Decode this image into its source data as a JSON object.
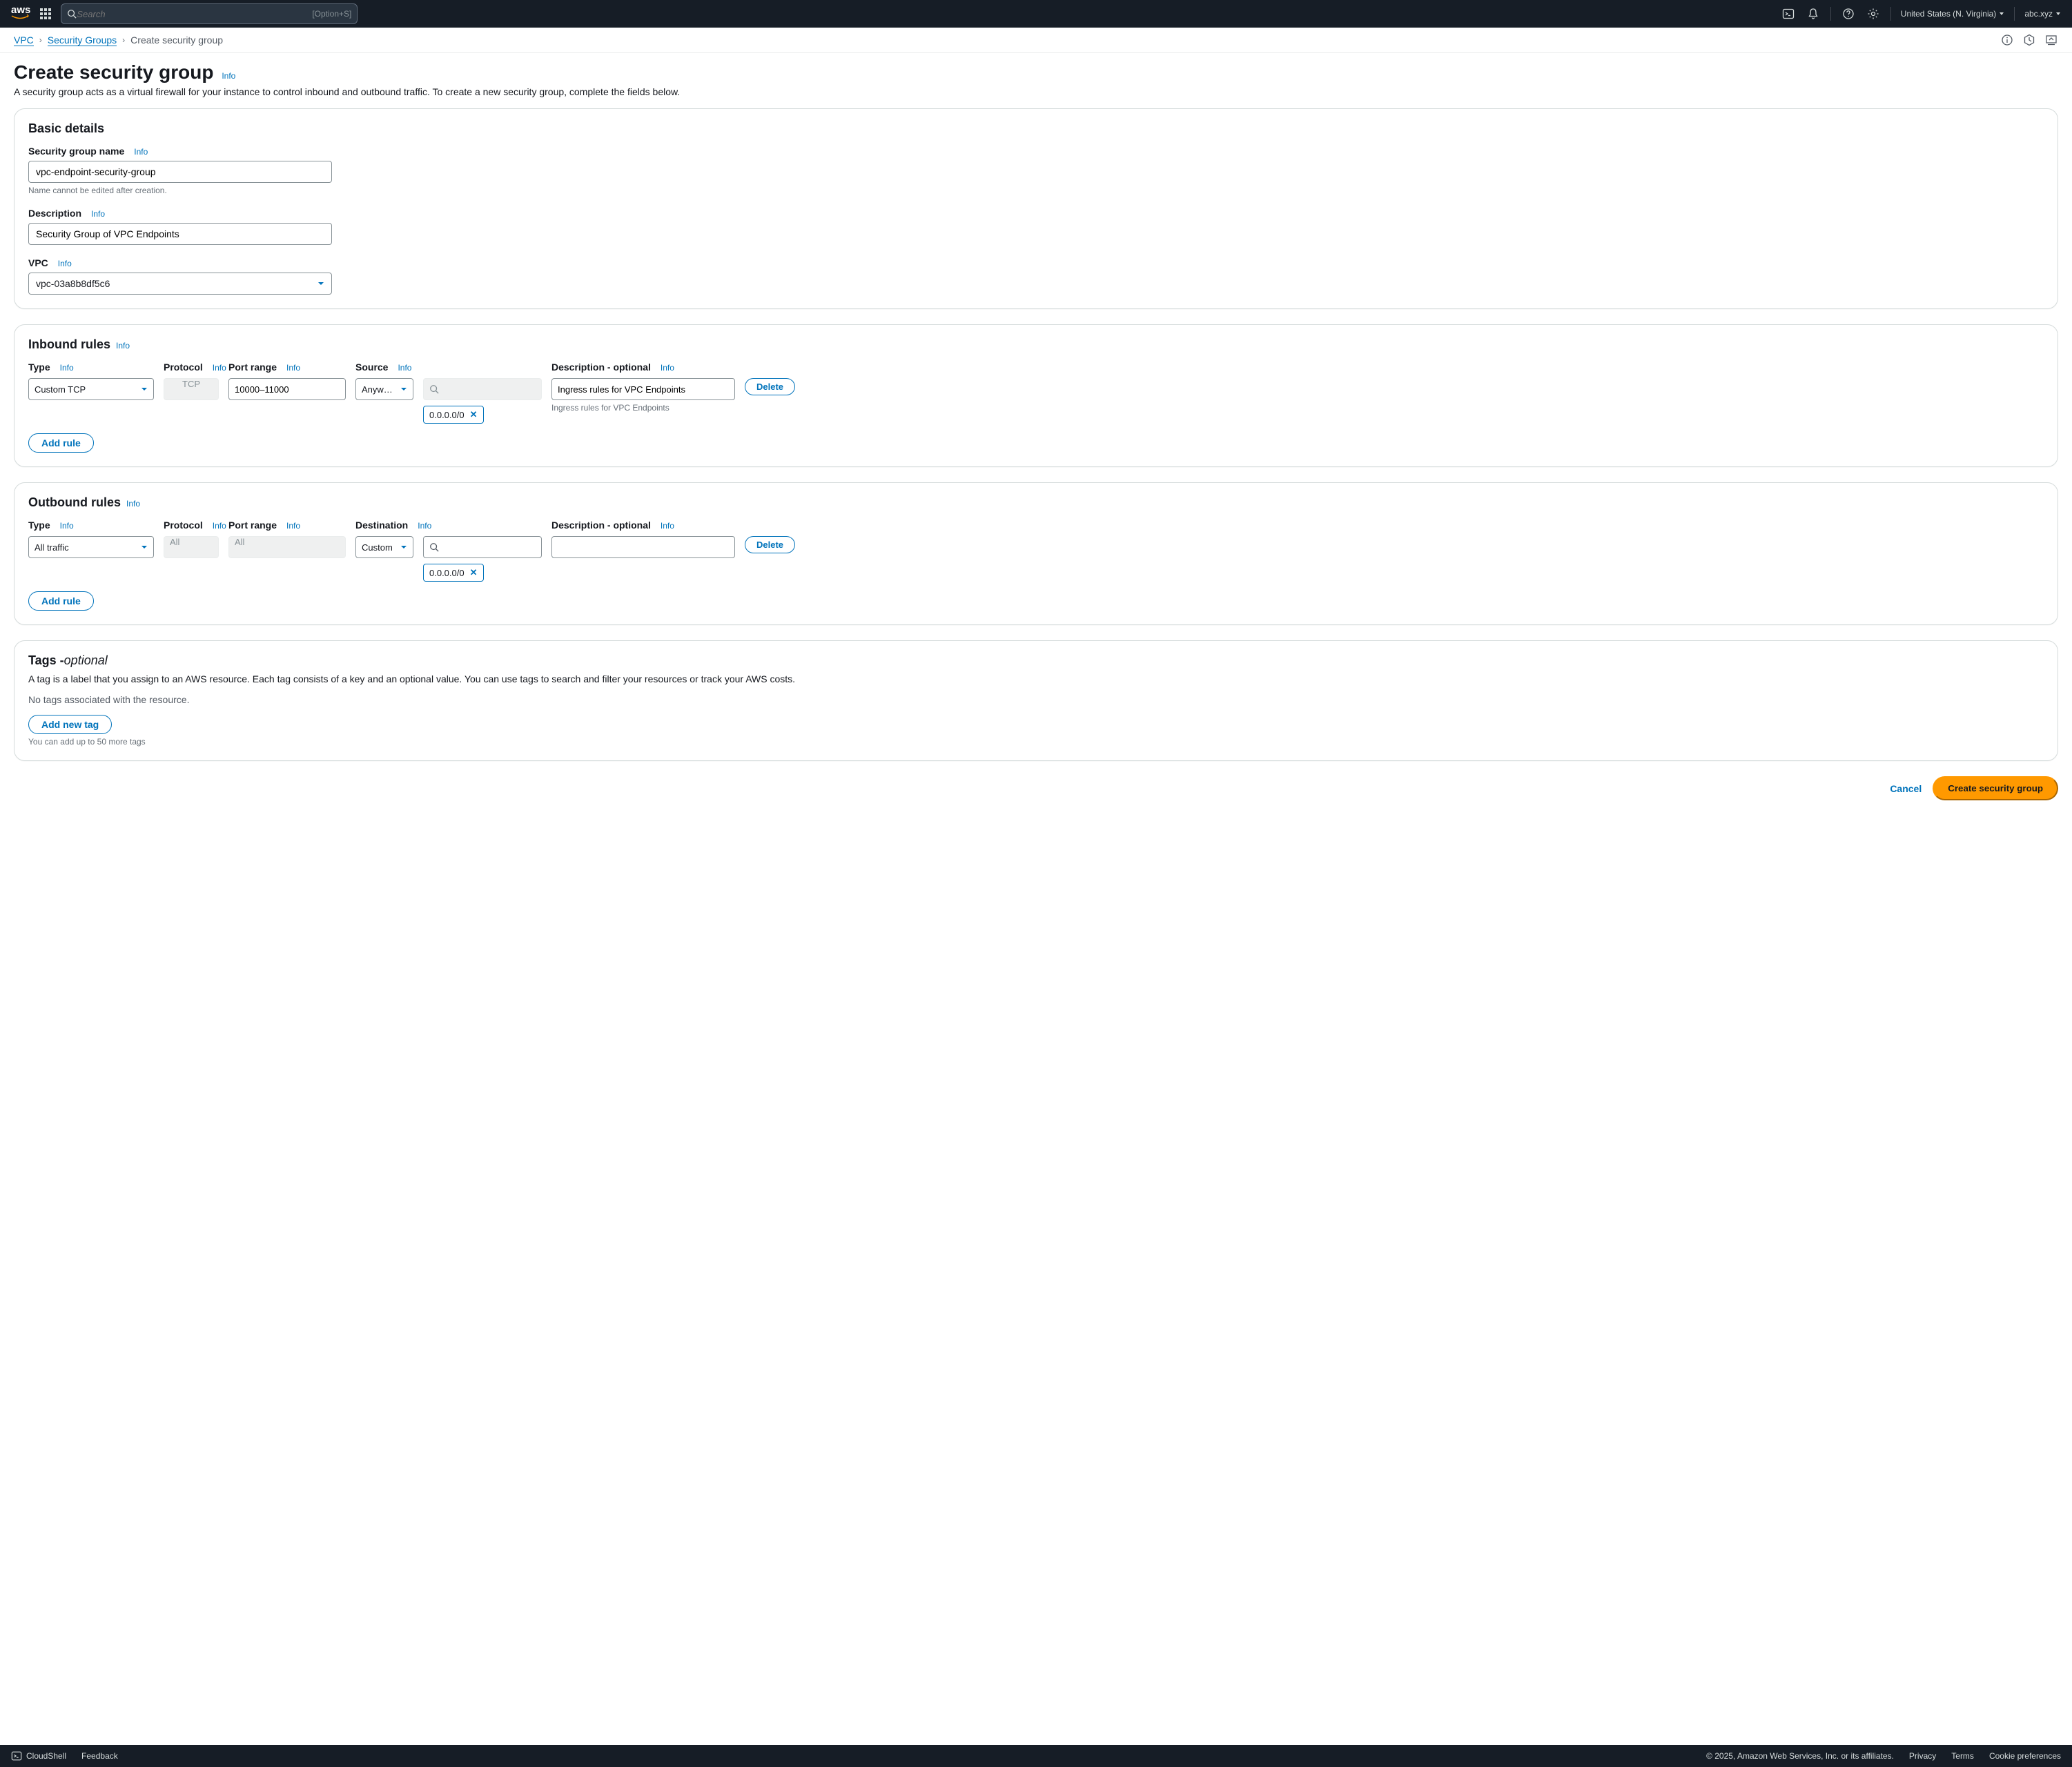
{
  "nav": {
    "search_placeholder": "Search",
    "search_hotkey": "[Option+S]",
    "region": "United States (N. Virginia)",
    "user": "abc.xyz"
  },
  "breadcrumb": {
    "vpc": "VPC",
    "sg": "Security Groups",
    "current": "Create security group"
  },
  "page": {
    "title": "Create security group",
    "info": "Info",
    "subtitle": "A security group acts as a virtual firewall for your instance to control inbound and outbound traffic. To create a new security group, complete the fields below."
  },
  "basic": {
    "heading": "Basic details",
    "name_label": "Security group name",
    "name_value": "vpc-endpoint-security-group",
    "name_helper": "Name cannot be edited after creation.",
    "desc_label": "Description",
    "desc_value": "Security Group of VPC Endpoints",
    "vpc_label": "VPC",
    "vpc_value": "vpc-03a8b8df5c6"
  },
  "inbound": {
    "heading": "Inbound rules",
    "cols": {
      "type": "Type",
      "protocol": "Protocol",
      "port": "Port range",
      "source": "Source",
      "desc": "Description - optional"
    },
    "row": {
      "type": "Custom TCP",
      "protocol": "TCP",
      "port": "10000–11000",
      "source": "Anyw…",
      "cidr": "0.0.0.0/0",
      "desc": "Ingress rules for VPC Endpoints",
      "desc_helper": "Ingress rules for VPC Endpoints"
    },
    "delete": "Delete",
    "add": "Add rule"
  },
  "outbound": {
    "heading": "Outbound rules",
    "cols": {
      "type": "Type",
      "protocol": "Protocol",
      "port": "Port range",
      "dest": "Destination",
      "desc": "Description - optional"
    },
    "row": {
      "type": "All traffic",
      "protocol": "All",
      "port": "All",
      "dest": "Custom",
      "cidr": "0.0.0.0/0",
      "desc": ""
    },
    "delete": "Delete",
    "add": "Add rule"
  },
  "tags": {
    "heading": "Tags - ",
    "heading_optional": "optional",
    "desc": "A tag is a label that you assign to an AWS resource. Each tag consists of a key and an optional value. You can use tags to search and filter your resources or track your AWS costs.",
    "empty": "No tags associated with the resource.",
    "add": "Add new tag",
    "limit": "You can add up to 50 more tags"
  },
  "actions": {
    "cancel": "Cancel",
    "create": "Create security group"
  },
  "footer": {
    "cloudshell": "CloudShell",
    "feedback": "Feedback",
    "copyright": "© 2025, Amazon Web Services, Inc. or its affiliates.",
    "privacy": "Privacy",
    "terms": "Terms",
    "cookie": "Cookie preferences"
  },
  "info": "Info"
}
